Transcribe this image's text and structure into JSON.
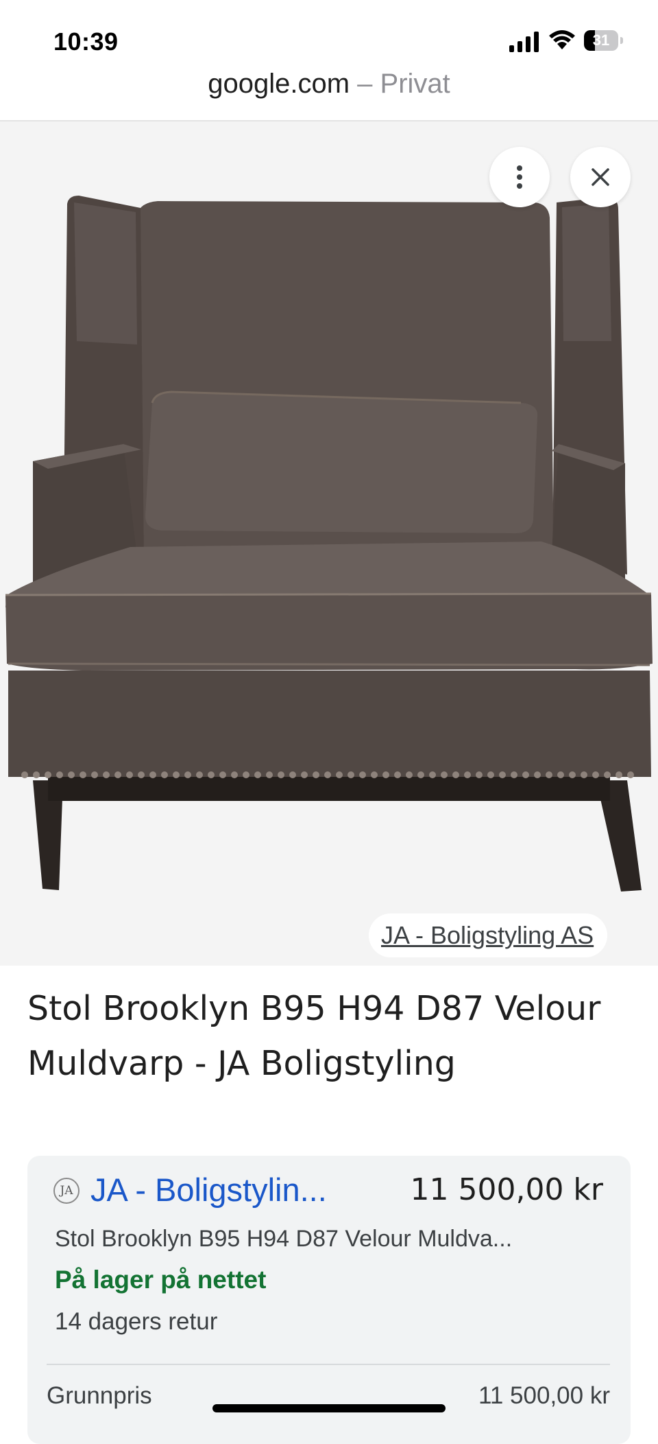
{
  "status_bar": {
    "time": "10:39",
    "battery_level": "31",
    "icons": [
      "cellular-signal-icon",
      "wifi-icon",
      "battery-icon"
    ]
  },
  "browser": {
    "host": "google.com",
    "separator": " – ",
    "mode": "Privat"
  },
  "image_viewer": {
    "more_icon": "more-vertical-icon",
    "close_icon": "close-icon",
    "source_label": "JA - Boligstyling AS"
  },
  "product": {
    "title": "Stol Brooklyn B95 H94 D87 Velour Muldvarp - JA Boligstyling"
  },
  "offer": {
    "seller_logo_text": "JA",
    "seller": "JA - Boligstylin...",
    "price": "11 500,00 kr",
    "description": "Stol Brooklyn B95 H94 D87 Velour Muldva...",
    "availability": "På lager på nettet",
    "returns": "14 dagers retur",
    "base_price_label": "Grunnpris",
    "base_price_value": "11 500,00 kr"
  },
  "colors": {
    "link_blue": "#1a57c9",
    "stock_green": "#137333",
    "card_bg": "#f1f3f4",
    "image_bg": "#f4f4f4"
  }
}
